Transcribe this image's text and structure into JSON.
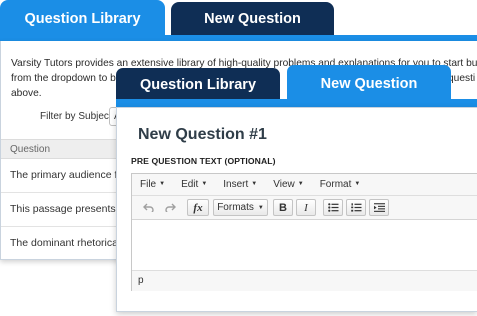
{
  "back_window": {
    "tabs": [
      {
        "label": "Question Library",
        "active": true
      },
      {
        "label": "New Question",
        "active": false
      }
    ],
    "intro_line1": "Varsity Tutors provides an extensive library of high-quality problems and explanations for you to start bu",
    "intro_line2": "from the dropdown to b",
    "intro_line2_right": "questi",
    "intro_line3": "above.",
    "filter_label": "Filter by Subject",
    "filter_value": "A",
    "table": {
      "header": "Question",
      "rows": [
        "The primary audience fo",
        "This passage presents",
        "The dominant rhetorical"
      ]
    }
  },
  "front_window": {
    "tabs": [
      {
        "label": "Question Library",
        "active": false
      },
      {
        "label": "New Question",
        "active": true
      }
    ],
    "title": "New Question #1",
    "field_label": "PRE QUESTION TEXT (OPTIONAL)",
    "editor": {
      "menus": [
        "File",
        "Edit",
        "Insert",
        "View",
        "Format"
      ],
      "toolbar": {
        "undo_icon": "undo-icon",
        "redo_icon": "redo-icon",
        "formula_label": "fx",
        "formats_label": "Formats",
        "bold_label": "B",
        "italic_label": "I",
        "bullet_list_icon": "bullet-list-icon",
        "numbered_list_icon": "numbered-list-icon",
        "indent_icon": "indent-icon"
      },
      "status_path": "p"
    }
  },
  "colors": {
    "active_tab": "#1b8ee6",
    "inactive_tab": "#0f2e55",
    "title_text": "#2f3d48"
  }
}
